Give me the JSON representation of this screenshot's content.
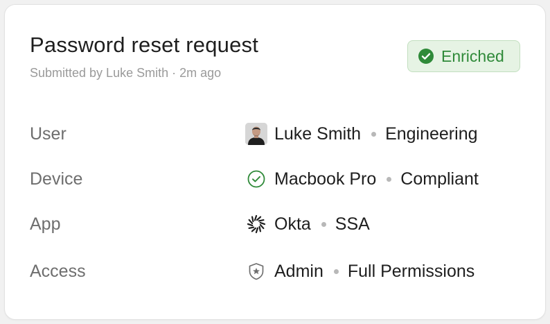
{
  "card": {
    "title": "Password reset request",
    "subtitle": "Submitted by Luke Smith · 2m ago",
    "status_badge": {
      "label": "Enriched",
      "icon": "check-circle-filled-icon",
      "text_color": "#2f8a39",
      "bg_color": "#e6f3e4",
      "border_color": "#c2dfbf"
    }
  },
  "rows": [
    {
      "label": "User",
      "icon": "avatar",
      "primary": "Luke Smith",
      "secondary": "Engineering"
    },
    {
      "label": "Device",
      "icon": "check-circle-outline-icon",
      "primary": "Macbook Pro",
      "secondary": "Compliant"
    },
    {
      "label": "App",
      "icon": "okta-logo-icon",
      "primary": "Okta",
      "secondary": "SSA"
    },
    {
      "label": "Access",
      "icon": "shield-star-icon",
      "primary": "Admin",
      "secondary": "Full Permissions"
    }
  ]
}
